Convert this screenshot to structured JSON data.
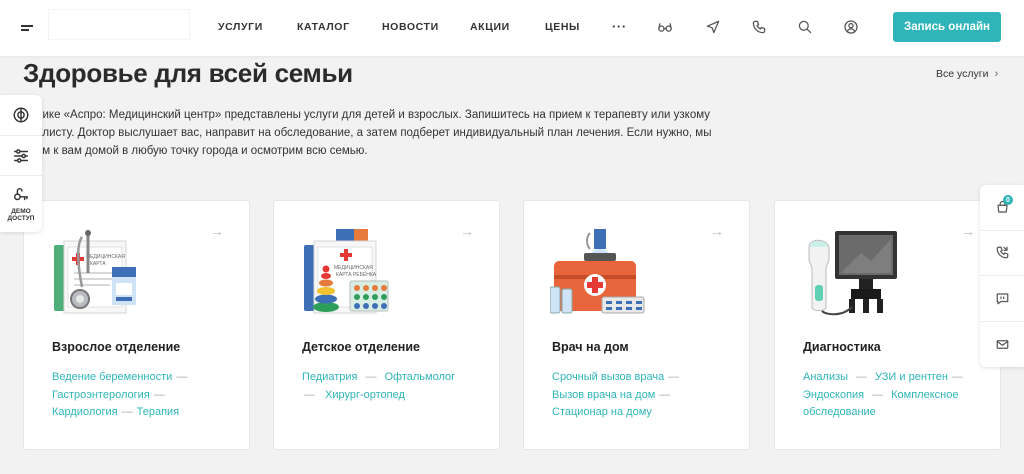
{
  "header": {
    "nav": [
      "УСЛУГИ",
      "КАТАЛОГ",
      "НОВОСТИ",
      "АКЦИИ",
      "ЦЕНЫ"
    ],
    "more": "···",
    "cta": "Запись онлайн"
  },
  "section": {
    "title": "Здоровье для всей семьи",
    "all_link": "Все услуги",
    "intro_lines": [
      "линике «Аспро: Медицинский центр» представлены услуги для детей и взрослых. Запишитесь на прием к терапевту или узкому",
      "циалисту. Доктор выслушает вас, направит на обследование, а затем подберет индивидуальный план лечения. Если нужно, мы",
      "едем к вам домой в любую точку города и осмотрим всю семью."
    ]
  },
  "left_panel": {
    "demo_label_1": "ДЕМО",
    "demo_label_2": "ДОСТУП"
  },
  "right_panel": {
    "cart_count": "0"
  },
  "cards": [
    {
      "title": "Взрослое отделение",
      "links": [
        "Ведение беременности",
        "Гастроэнтерология",
        "Кардиология",
        "Терапия"
      ]
    },
    {
      "title": "Детское отделение",
      "links": [
        "Педиатрия",
        "Офтальмолог",
        "Хирург-ортопед"
      ]
    },
    {
      "title": "Врач на дом",
      "links": [
        "Срочный вызов врача",
        "Вызов врача на дом",
        "Стационар на дому"
      ]
    },
    {
      "title": "Диагностика",
      "links": [
        "Анализы",
        "УЗИ и рентген",
        "Эндоскопия",
        "Комплексное обследование"
      ]
    }
  ],
  "colors": {
    "accent": "#2fb5b9",
    "background": "#f2f2f2"
  }
}
